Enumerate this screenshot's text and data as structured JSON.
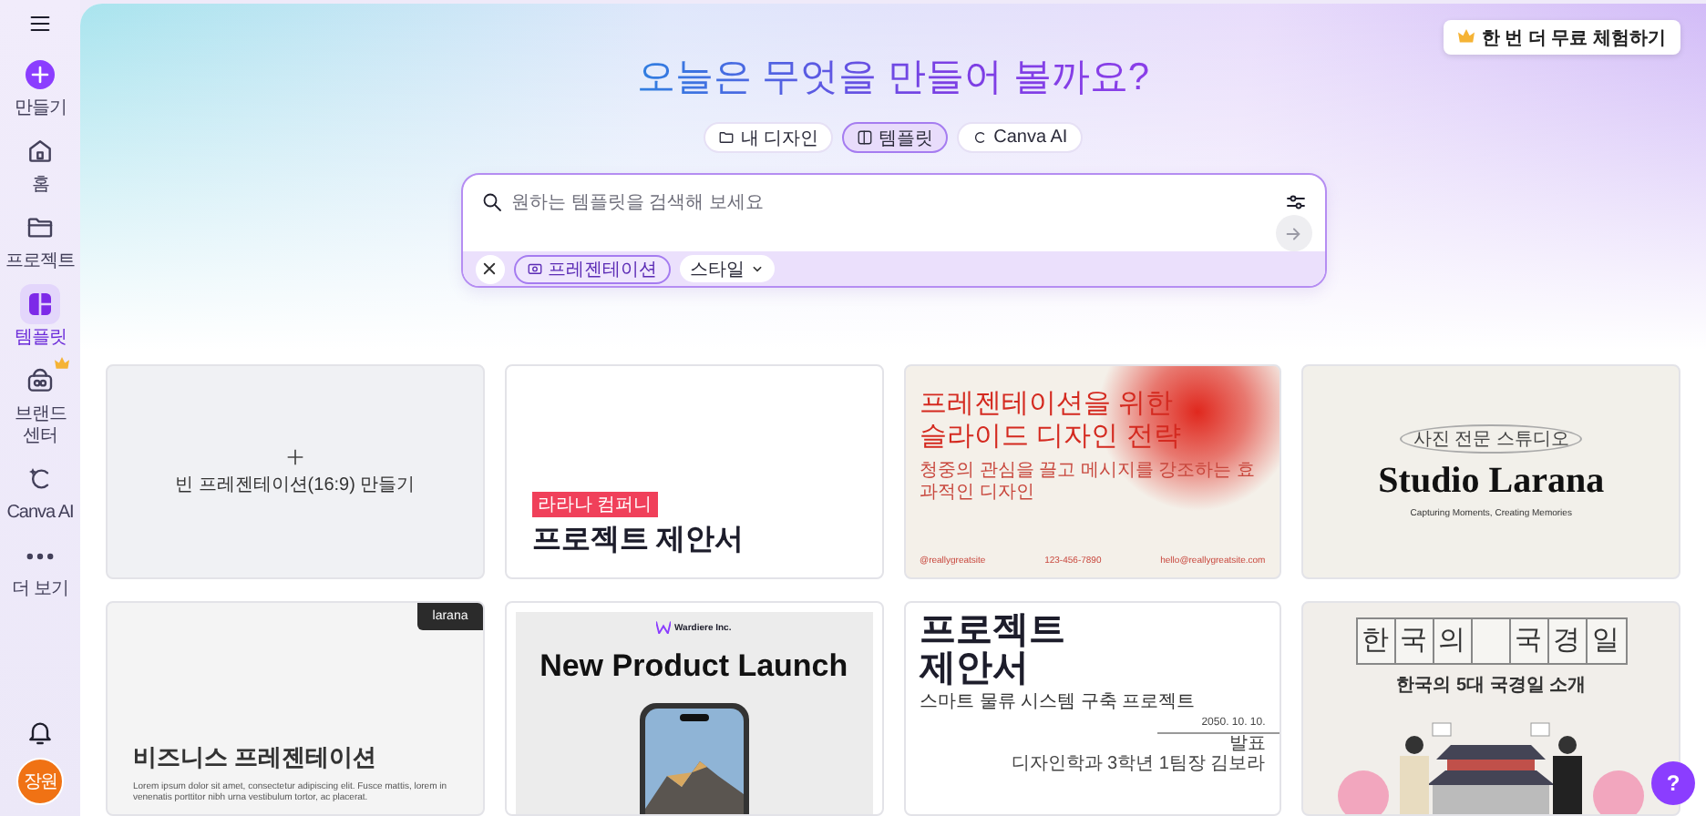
{
  "sidebar": {
    "items": [
      {
        "kind": "create",
        "label": "만들기",
        "selected": false
      },
      {
        "kind": "home",
        "label": "홈",
        "selected": false
      },
      {
        "kind": "projects",
        "label": "프로젝트",
        "selected": false
      },
      {
        "kind": "templates",
        "label": "템플릿",
        "selected": true
      },
      {
        "kind": "brand",
        "label": "브랜드 센터",
        "selected": false
      },
      {
        "kind": "ai",
        "label": "Canva AI",
        "selected": false
      },
      {
        "kind": "more",
        "label": "더 보기",
        "selected": false
      }
    ],
    "avatar": "장원"
  },
  "upgrade_button": "한 번 더 무료 체험하기",
  "heading": "오늘은 무엇을 만들어 볼까요?",
  "tabs": [
    {
      "kind": "designs",
      "label": "내 디자인",
      "selected": false
    },
    {
      "kind": "templates",
      "label": "템플릿",
      "selected": true
    },
    {
      "kind": "ai",
      "label": "Canva AI",
      "selected": false
    }
  ],
  "search": {
    "placeholder": "원하는 템플릿을 검색해 보세요",
    "filter_chip": "프레젠테이션",
    "style_dropdown": "스타일"
  },
  "templates": [
    {
      "kind": "blank",
      "label": "빈 프레젠테이션(16:9) 만들기"
    },
    {
      "kind": "proposal",
      "tag": "라라나 컴퍼니",
      "title": "프로젝트 제안서"
    },
    {
      "kind": "strategy",
      "title": "프레젠테이션을 위한 슬라이드 디자인 전략",
      "subtitle": "청중의 관심을 끌고 메시지를 강조하는 효과적인 디자인",
      "footer": [
        "@reallygreatsite",
        "123-456-7890",
        "hello@reallygreatsite.com"
      ]
    },
    {
      "kind": "studio",
      "pill": "사진 전문 스튜디오",
      "title": "Studio Larana",
      "caption": "Capturing Moments, Creating Memories"
    },
    {
      "kind": "business",
      "tag": "larana",
      "title": "비즈니스 프레젠테이션",
      "body": "Lorem ipsum dolor sit amet, consectetur adipiscing elit. Fusce mattis, lorem in venenatis porttitor nibh urna vestibulum tortor, ac placerat."
    },
    {
      "kind": "launch",
      "brand": "Wardiere Inc.",
      "title": "New Product Launch"
    },
    {
      "kind": "proposal_tall",
      "title": "프로젝트 제안서",
      "subtitle": "스마트 물류 시스템 구축 프로젝트",
      "date": "2050. 10. 10.",
      "role": "발표",
      "presenter": "디자인학과 3학년 1팀장 김보라"
    },
    {
      "kind": "holidays",
      "title_left": [
        "한",
        "국",
        "의"
      ],
      "title_right": [
        "국",
        "경",
        "일"
      ],
      "subtitle": "한국의 5대 국경일 소개"
    }
  ],
  "help_button": "?"
}
